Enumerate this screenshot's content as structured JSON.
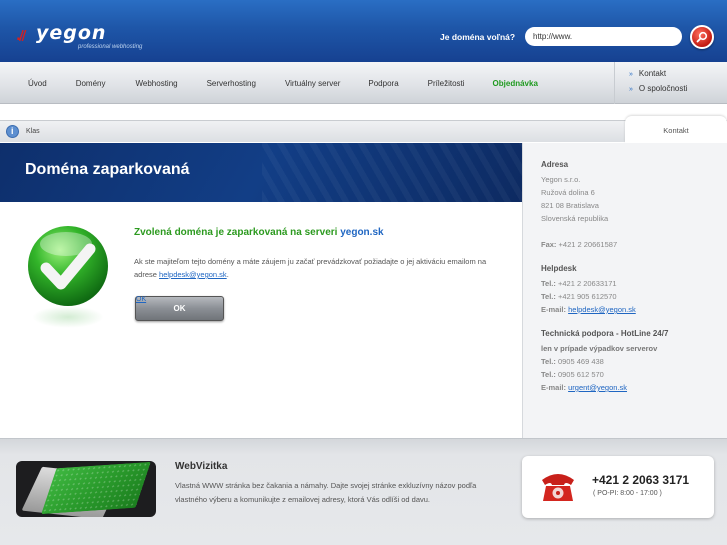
{
  "header": {
    "logo_mark": ".//",
    "logo_word": "yegon",
    "logo_tagline": "professional webhosting",
    "domain_question": "Je doména voľná?",
    "domain_input_value": "http://www.",
    "search_icon": "magnifier-icon"
  },
  "nav": {
    "items": [
      {
        "label": "Úvod"
      },
      {
        "label": "Domény"
      },
      {
        "label": "Webhosting"
      },
      {
        "label": "Serverhosting"
      },
      {
        "label": "Virtuálny server"
      },
      {
        "label": "Podpora"
      },
      {
        "label": "Príležitosti"
      },
      {
        "label": "Objednávka"
      }
    ],
    "side_links": [
      {
        "label": "Kontakt"
      },
      {
        "label": "O spoločnosti"
      }
    ],
    "arrow": "»"
  },
  "breadcrumb": {
    "home_glyph": "i",
    "label": "Klas",
    "contact_tab": "Kontakt"
  },
  "main": {
    "title": "Doména zaparkovaná",
    "heading_prefix": "Zvolená doména je zaparkovaná na serveri",
    "heading_link": "yegon.sk",
    "text_prefix": "Ak ste majiteľom tejto domény a máte záujem ju začať prevádzkovať požiadajte o jej aktiváciu emailom na adrese",
    "text_email": "helpdesk@yegon.sk",
    "text_suffix": ".",
    "ok_mini": "OK",
    "ok_label": "OK"
  },
  "contact": {
    "address_head": "Adresa",
    "address_lines": [
      "Yegon s.r.o.",
      "Ružová dolina 6",
      "821 08 Bratislava",
      "Slovenská republika"
    ],
    "fax_label": "Fax:",
    "fax_value": "+421 2 20661587",
    "helpdesk_head": "Helpdesk",
    "tel_label": "Tel.:",
    "helpdesk_tel1": "+421 2 20633171",
    "helpdesk_tel2": "+421 905 612570",
    "email_label": "E-mail:",
    "helpdesk_email": "helpdesk@yegon.sk",
    "tech_head": "Technická podpora - HotLine 24/7",
    "tech_note": "len v prípade výpadkov serverov",
    "tech_tel1": "0905 469 438",
    "tech_tel2": "0905 612 570",
    "tech_email": "urgent@yegon.sk"
  },
  "footer": {
    "webviz_title": "WebVizitka",
    "webviz_text": "Vlastná WWW stránka bez čakania a námahy. Dajte svojej stránke exkluzívny názov podľa vlastného výberu a komunikujte z emailovej adresy, ktorá Vás odlíši od davu.",
    "phone_number": "+421 2 2063 3171",
    "phone_hours": "( PO-PI: 8:00 - 17:00 )",
    "phone_icon": "telephone-icon"
  },
  "colors": {
    "header_blue": "#1e56a8",
    "title_band": "#123e86",
    "success_green": "#2c9a1f",
    "link_blue": "#1f66c2",
    "search_red": "#c21a10"
  }
}
